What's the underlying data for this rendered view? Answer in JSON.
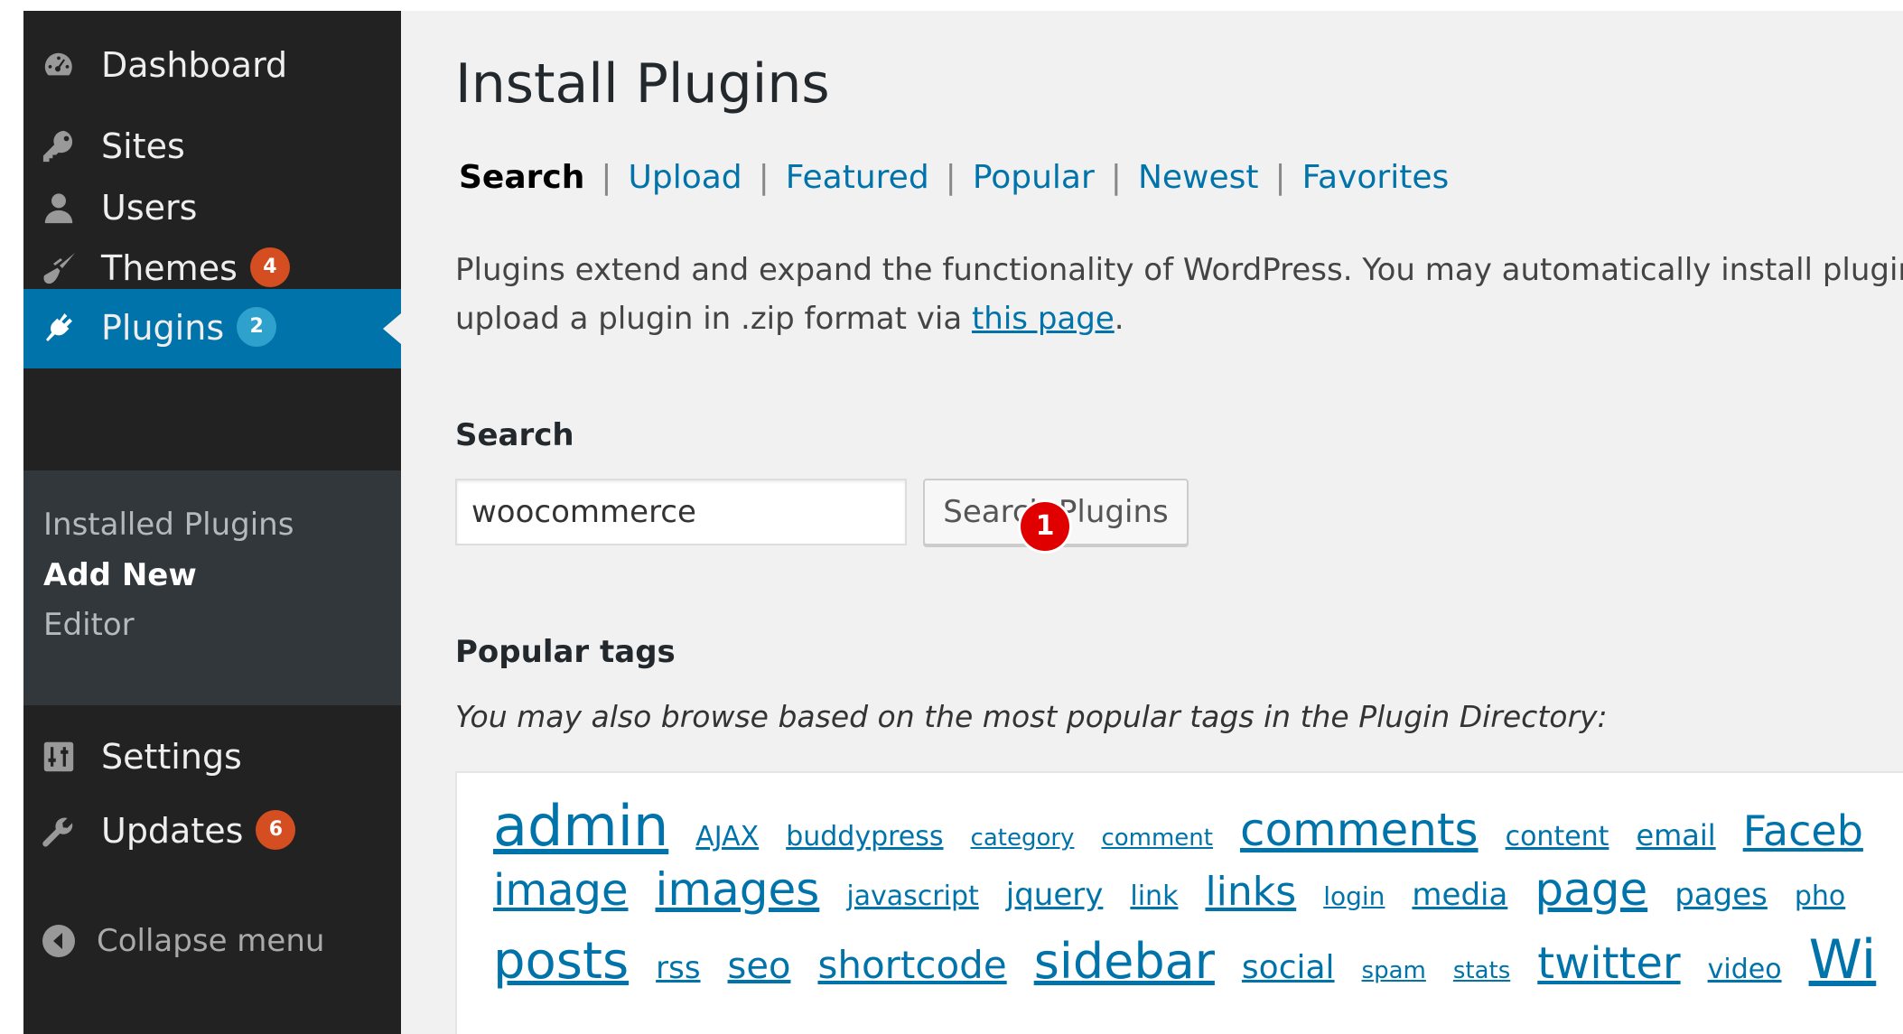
{
  "sidebar": {
    "items": [
      {
        "label": "Dashboard",
        "icon": "dashboard-icon"
      },
      {
        "label": "Sites",
        "icon": "key-icon"
      },
      {
        "label": "Users",
        "icon": "user-icon"
      },
      {
        "label": "Themes",
        "icon": "paintbrush-icon",
        "badge": "4"
      },
      {
        "label": "Plugins",
        "icon": "plug-icon",
        "badge": "2"
      },
      {
        "label": "Settings",
        "icon": "sliders-icon"
      },
      {
        "label": "Updates",
        "icon": "wrench-icon",
        "badge": "6"
      }
    ],
    "submenu": [
      "Installed Plugins",
      "Add New",
      "Editor"
    ],
    "collapse_label": "Collapse menu"
  },
  "main": {
    "title": "Install Plugins",
    "tabs": [
      "Search",
      "Upload",
      "Featured",
      "Popular",
      "Newest",
      "Favorites"
    ],
    "description_line1": "Plugins extend and expand the functionality of WordPress. You may automatically install plugins fro",
    "description_line2_prefix": "upload a plugin in .zip format via ",
    "description_link": "this page",
    "description_suffix": ".",
    "search_heading": "Search",
    "search_value": "woocommerce",
    "search_button": "Search Plugins",
    "step_marker": "1",
    "tags_heading": "Popular tags",
    "tags_intro": "You may also browse based on the most popular tags in the Plugin Directory:",
    "tag_rows": [
      [
        "admin",
        "AJAX",
        "buddypress",
        "category",
        "comment",
        "comments",
        "content",
        "email",
        "Faceb"
      ],
      [
        "image",
        "images",
        "javascript",
        "jquery",
        "link",
        "links",
        "login",
        "media",
        "page",
        "pages",
        "pho"
      ],
      [
        "posts",
        "rss",
        "seo",
        "shortcode",
        "sidebar",
        "social",
        "spam",
        "stats",
        "twitter",
        "video",
        "Wi"
      ]
    ]
  },
  "colors": {
    "sidebar_bg": "#222222",
    "submenu_bg": "#32373c",
    "active_bg": "#0073aa",
    "badge_orange": "#d54e21",
    "badge_blue": "#2ea2cc",
    "link": "#0073aa",
    "marker_red": "#e00000"
  }
}
